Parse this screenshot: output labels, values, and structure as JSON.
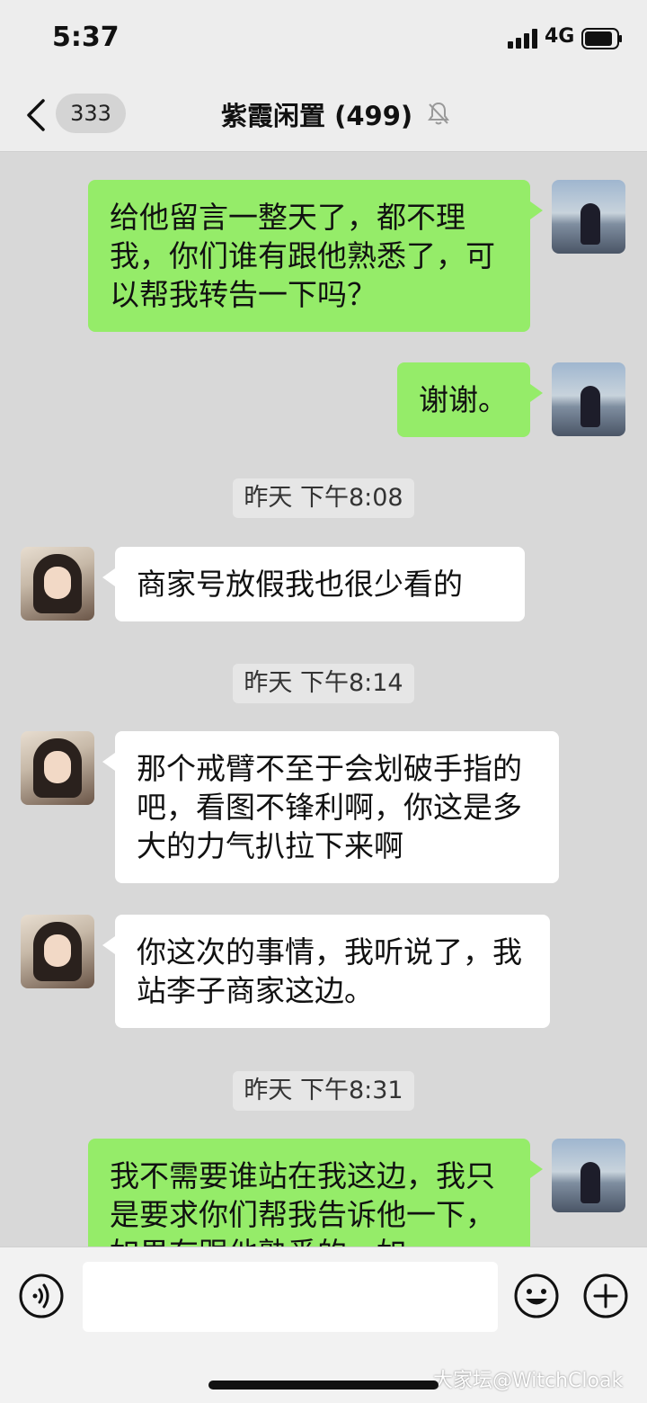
{
  "status_bar": {
    "time": "5:37",
    "network": "4G"
  },
  "nav": {
    "unread_count": "333",
    "title": "紫霞闲置 (499)"
  },
  "messages": [
    {
      "sender": "self",
      "text": "给他留言一整天了，都不理我，你们谁有跟他熟悉了，可以帮我转告一下吗？"
    },
    {
      "sender": "self",
      "text": "谢谢。"
    },
    {
      "type": "time",
      "text": "昨天 下午8:08"
    },
    {
      "sender": "other",
      "text": "商家号放假我也很少看的"
    },
    {
      "type": "time",
      "text": "昨天 下午8:14"
    },
    {
      "sender": "other",
      "text": "那个戒臂不至于会划破手指的吧，看图不锋利啊，你这是多大的力气扒拉下来啊"
    },
    {
      "sender": "other",
      "text": "你这次的事情，我听说了，我站李子商家这边。"
    },
    {
      "type": "time",
      "text": "昨天 下午8:31"
    },
    {
      "sender": "self",
      "text": "我不需要谁站在我这边，我只是要求你们帮我告诉他一下，如果有跟他熟悉的，如"
    }
  ],
  "watermark": "大家坛@WitchCloak",
  "icons": {
    "back": "chevron-left-icon",
    "mute": "bell-slash-icon",
    "voice": "voice-icon",
    "emoji": "emoji-icon",
    "plus": "plus-icon"
  }
}
